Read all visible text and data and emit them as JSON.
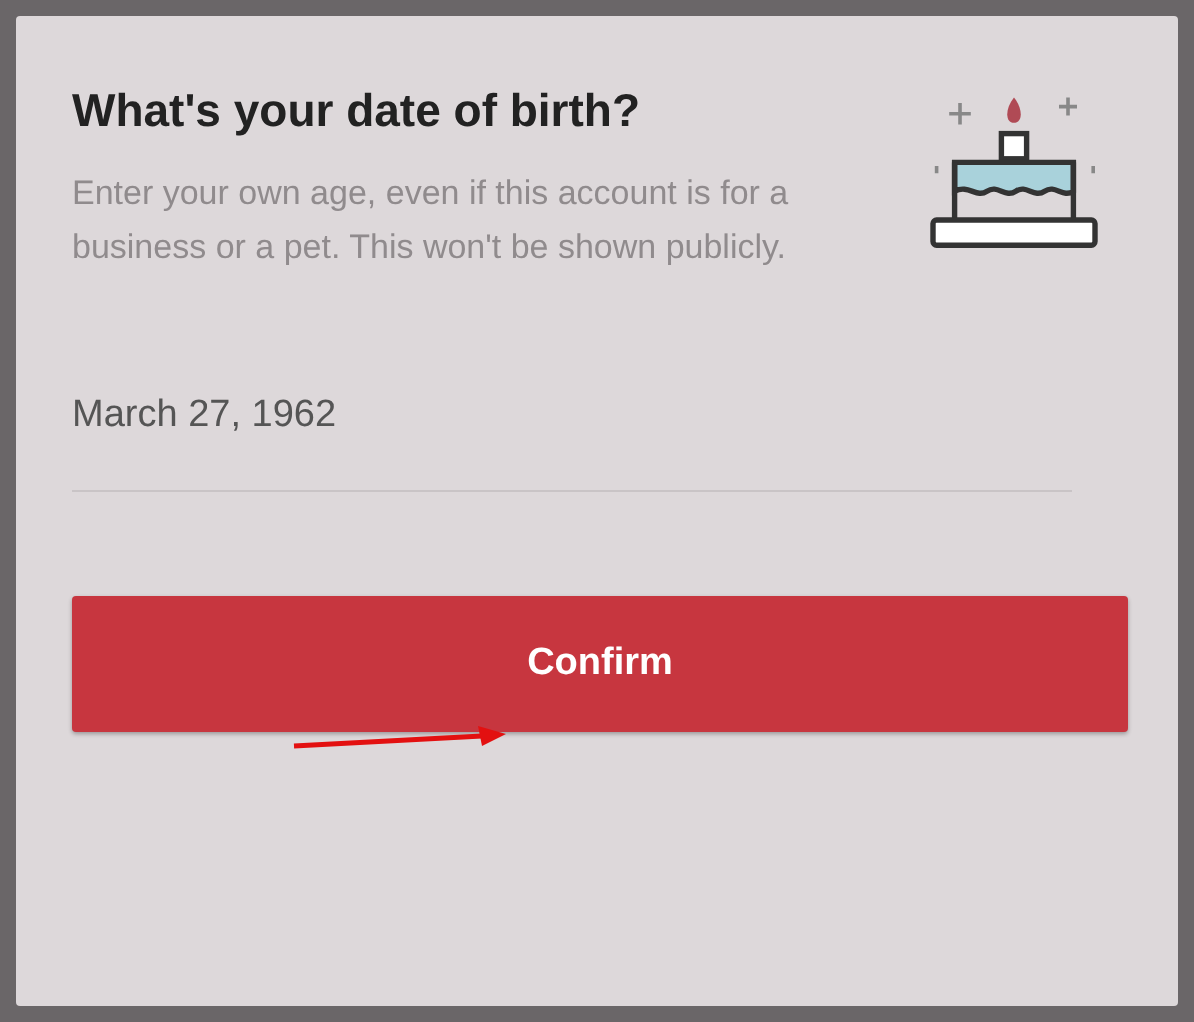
{
  "title": "What's your date of birth?",
  "description": "Enter your own age, even if this account is for a business or a pet. This won't be shown publicly.",
  "date_field": {
    "value": "March 27, 1962"
  },
  "confirm_button": {
    "label": "Confirm"
  }
}
